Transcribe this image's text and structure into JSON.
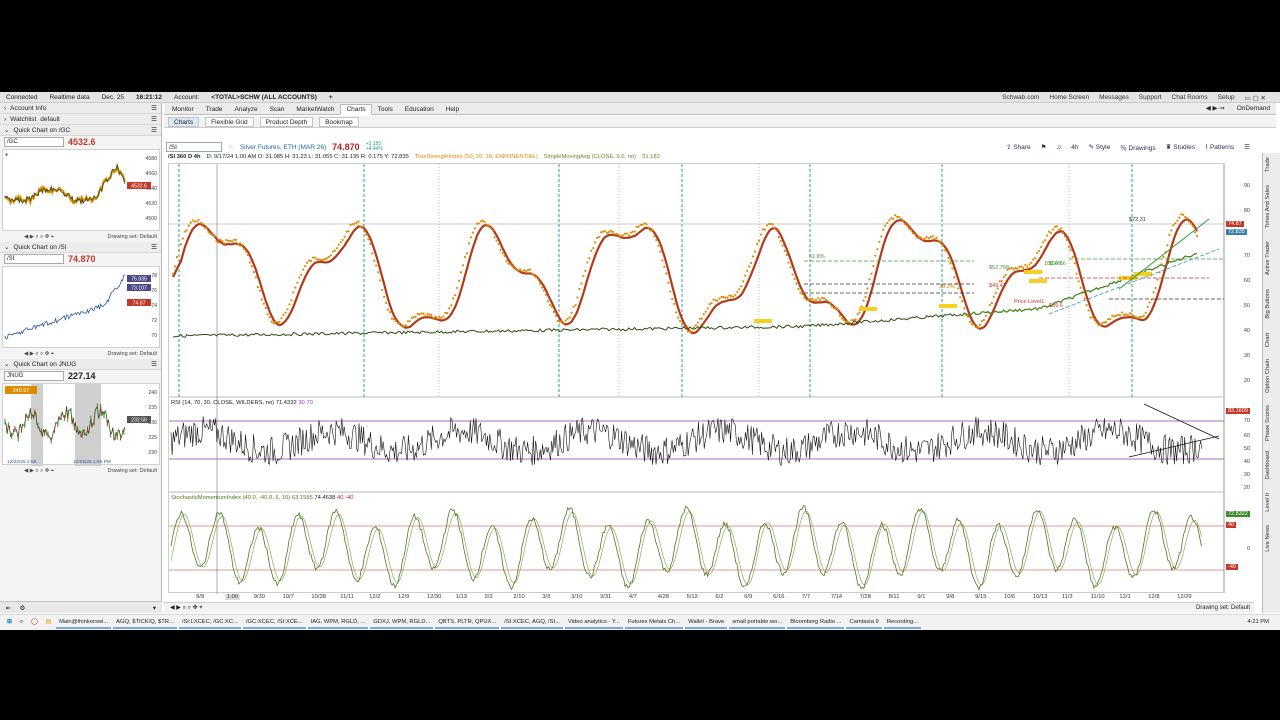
{
  "status": {
    "connected": "Connected",
    "realtime": "Realtime data",
    "date": "Dec. 25",
    "time": "16:21:12",
    "account_label": "Account:",
    "account": "<TOTAL>SCHW (ALL ACCOUNTS)",
    "add": "+"
  },
  "toplinks": [
    "Schwab.com",
    "Home Screen",
    "Messages",
    "Support",
    "Chat Rooms",
    "Setup"
  ],
  "menu": [
    "Monitor",
    "Trade",
    "Analyze",
    "Scan",
    "MarketWatch",
    "Charts",
    "Tools",
    "Education",
    "Help"
  ],
  "menu_active": "Charts",
  "ondemand": "OnDemand",
  "subtabs": [
    "Charts",
    "Flexible Grid",
    "Product Depth",
    "Bookmap"
  ],
  "left": {
    "account_info": "Account Info",
    "watchlist": "Watchlist",
    "watchlist_value": "default",
    "qc1_title": "Quick Chart on /GC",
    "qc1_symbol": "/GC",
    "qc1_price": "4532.6",
    "qc1_ticks": [
      "4580",
      "4560",
      "4540",
      "4520",
      "4500"
    ],
    "qc1_tag": "4532.6",
    "qc2_title": "Quick Chart on /SI",
    "qc2_symbol": "/SI",
    "qc2_price": "74.870",
    "qc2_ticks": [
      "78",
      "76",
      "74",
      "72",
      "70"
    ],
    "qc2_tags": [
      "75.935",
      "74.87",
      "73.107"
    ],
    "qc3_title": "Quick Chart on JNUG",
    "qc3_symbol": "JNUG",
    "qc3_price": "227.14",
    "qc3_ticks": [
      "240",
      "235",
      "230",
      "225",
      "220"
    ],
    "qc3_tag": "232.56",
    "qc3_box": "240.97",
    "qc3_dates": [
      "12/22/25 2:55",
      "12/25/25 1:55 PM"
    ],
    "drawing_set": "Drawing set: Default"
  },
  "chart": {
    "symbol": "/SI",
    "description": "Silver Futures, ETH (MAR 26)",
    "price": "74.870",
    "change_lines": [
      "+3.185",
      "+4.44%"
    ],
    "period": "/SI 360 D 4h",
    "ohlc": "D: 9/17/24 1:00 AM   O: 31.085   H: 31.23   L: 31.055   C: 31.135   R: 0.175   Y: 72.835",
    "tsi_label": "TrueStrengthIndex (50, 26, 16, EXPONENTIAL)",
    "sma_label": "SimpleMovingAvg (CLOSE, 9.0, no)",
    "sma_value": "31.182",
    "tools": [
      "Share",
      "4h",
      "Style",
      "Drawings",
      "Studies",
      "Patterns"
    ],
    "price_ticks": [
      "90",
      "80",
      "70",
      "60",
      "50",
      "40",
      "30",
      "20"
    ],
    "price_tags": [
      "74.87",
      "72.835"
    ],
    "rsi_label": "RSI (14, 70, 30, CLOSE, WILDERS, no)",
    "rsi_values": [
      "71.4332",
      "30",
      "70"
    ],
    "rsi_ticks": [
      "80",
      "70",
      "60",
      "50",
      "40",
      "30",
      "20"
    ],
    "rsi_tag": "83.1609",
    "smi_label": "StochasticMomentumIndex (40.0, -40.0, 6, 10)",
    "smi_values": [
      "63.1555",
      "74.4638",
      "40",
      "-40"
    ],
    "smi_ticks": [
      "40",
      "0",
      "-40"
    ],
    "smi_tag": "72.8322",
    "annotations": [
      "$52.798",
      "$54.56",
      "$72.31",
      "$39.6",
      "$49.41",
      "Price Level1",
      "100.0%",
      "38.2%",
      "61.8%"
    ],
    "x_labels": [
      "9/9",
      "1:00",
      "9/30",
      "10/7",
      "10/28",
      "11/11",
      "12/2",
      "12/9",
      "12/30",
      "1/13",
      "2/3",
      "2/10",
      "3/3",
      "3/10",
      "3/31",
      "4/7",
      "4/28",
      "5/12",
      "6/2",
      "6/9",
      "6/16",
      "7/7",
      "7/14",
      "7/28",
      "8/11",
      "9/1",
      "9/8",
      "9/15",
      "10/6",
      "10/13",
      "11/3",
      "11/10",
      "12/1",
      "12/8",
      "12/29"
    ],
    "drawing_set": "Drawing set: Default",
    "vtabs": [
      "Trade",
      "Times And Sales",
      "Active Trader",
      "Big Buttons",
      "Chart",
      "Option Chain",
      "Phase Scores",
      "Dashboard",
      "Level II",
      "Live News"
    ]
  },
  "taskbar": {
    "items": [
      "Main@thinkorswi...",
      "AGQ, $TICK/Q, $TR...",
      "/SI:LXCEC, /GC:XC...",
      "/GC:XCEC, /SI:XCE...",
      "IAG, WPM, RGLD, ...",
      "GDXJ, WPM, RGLD...",
      "QBTS, PLTR, QPUX...",
      "/SI:XCEC, AGQ, /SI...",
      "Video analytics - Y...",
      "Futures Metals Ch...",
      "Wallet - Brave",
      "small portable wo...",
      "Bloomberg Radio ...",
      "Camtasia 9",
      "Recording..."
    ],
    "clock": "4:21 PM"
  },
  "colors": {
    "tsi": "#e08a00",
    "tsi_signal": "#b03a1a",
    "sma": "#2f4a12",
    "rsi": "#111111",
    "smi": "#4c7a1e",
    "dividers": "#26a690",
    "price_tag": "#c0392b"
  }
}
